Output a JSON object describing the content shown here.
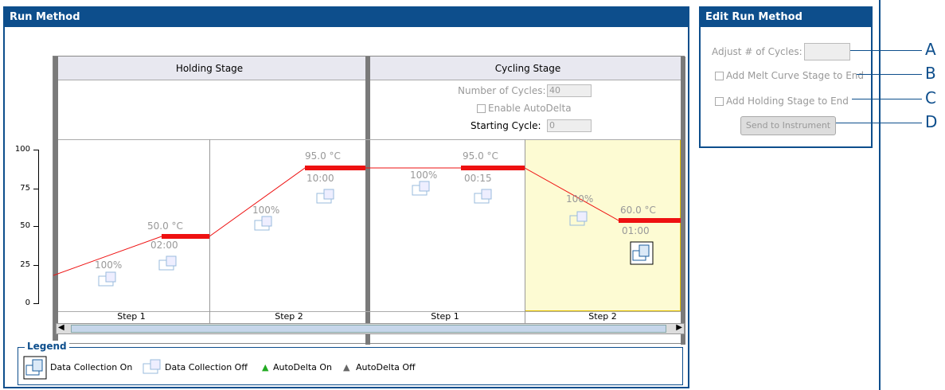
{
  "run_method": {
    "title": "Run Method",
    "holding_stage": "Holding Stage",
    "cycling_stage": "Cycling Stage",
    "num_cycles_label": "Number of Cycles:",
    "num_cycles_value": "40",
    "enable_autodelta": "Enable AutoDelta",
    "starting_cycle_label": "Starting Cycle:",
    "starting_cycle_value": "0",
    "y_ticks": [
      "100",
      "75",
      "50",
      "25",
      "0"
    ],
    "steps": [
      {
        "label": "Step 1",
        "temp": "50.0 °C",
        "time": "02:00",
        "pct": "100%"
      },
      {
        "label": "Step 2",
        "temp": "95.0 °C",
        "time": "10:00",
        "pct": "100%"
      },
      {
        "label": "Step 1",
        "temp": "95.0 °C",
        "time": "00:15",
        "pct": "100%"
      },
      {
        "label": "Step 2",
        "temp": "60.0 °C",
        "time": "01:00",
        "pct": "100%"
      }
    ]
  },
  "legend": {
    "title": "Legend",
    "items": [
      "Data Collection On",
      "Data Collection Off",
      "AutoDelta On",
      "AutoDelta Off"
    ],
    "colors": {
      "autodelta_on": "#22aa22",
      "autodelta_off": "#666666"
    }
  },
  "edit_run_method": {
    "title": "Edit Run Method",
    "adjust_cycles": "Adjust # of Cycles:",
    "add_melt": "Add Melt Curve Stage to End",
    "add_holding": "Add Holding Stage to End",
    "send": "Send to Instrument"
  },
  "callouts": [
    "A",
    "B",
    "C",
    "D"
  ],
  "colors": {
    "accent": "#0d4e8c",
    "hold_bar": "#ee1111",
    "highlight": "#fdfbd3"
  }
}
